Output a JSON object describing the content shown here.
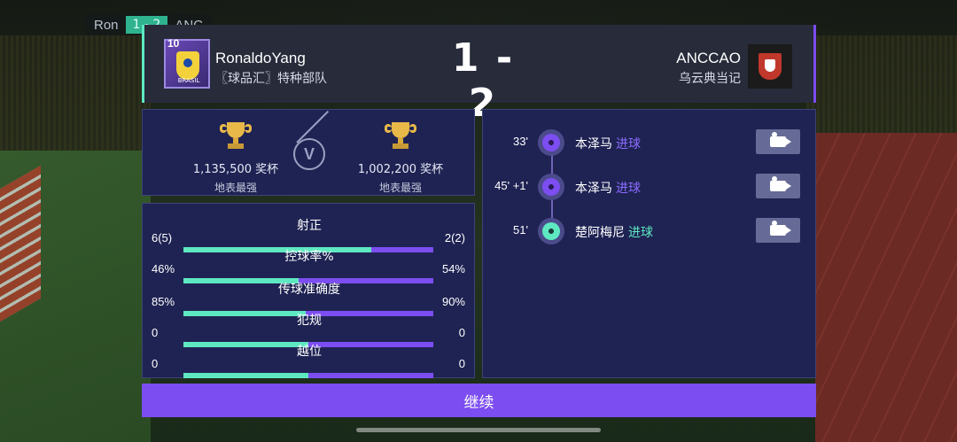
{
  "top_mini": {
    "left": "Ron",
    "score": "1 - 2",
    "right": "ANC"
  },
  "match": {
    "left": {
      "name": "RonaldoYang",
      "team": "〖球品汇〗特种部队",
      "level": "10",
      "badge_text": "BRASIL"
    },
    "score": "1 - 2",
    "right": {
      "name": "ANCCAO",
      "team": "乌云典当记"
    }
  },
  "trophies": {
    "left": {
      "count": "1,135,500 奖杯",
      "rank": "地表最强"
    },
    "right": {
      "count": "1,002,200 奖杯",
      "rank": "地表最强"
    },
    "vs": "V"
  },
  "stats": [
    {
      "label": "射正",
      "left": "6(5)",
      "right": "2(2)",
      "left_share": 0.75
    },
    {
      "label": "控球率%",
      "left": "46%",
      "right": "54%",
      "left_share": 0.46
    },
    {
      "label": "传球准确度",
      "left": "85%",
      "right": "90%",
      "left_share": 0.49
    },
    {
      "label": "犯规",
      "left": "0",
      "right": "0",
      "left_share": 0.5
    },
    {
      "label": "越位",
      "left": "0",
      "right": "0",
      "left_share": 0.5
    }
  ],
  "events": [
    {
      "time": "33'",
      "player": "本泽马",
      "action": "进球",
      "side": "purple"
    },
    {
      "time": "45' +1'",
      "player": "本泽马",
      "action": "进球",
      "side": "purple"
    },
    {
      "time": "51'",
      "player": "楚阿梅尼",
      "action": "进球",
      "side": "teal"
    }
  ],
  "continue_label": "继续",
  "colors": {
    "home": "#5ee8c1",
    "away": "#7c4df0",
    "panel": "#1f2353",
    "header": "#272b3a"
  }
}
